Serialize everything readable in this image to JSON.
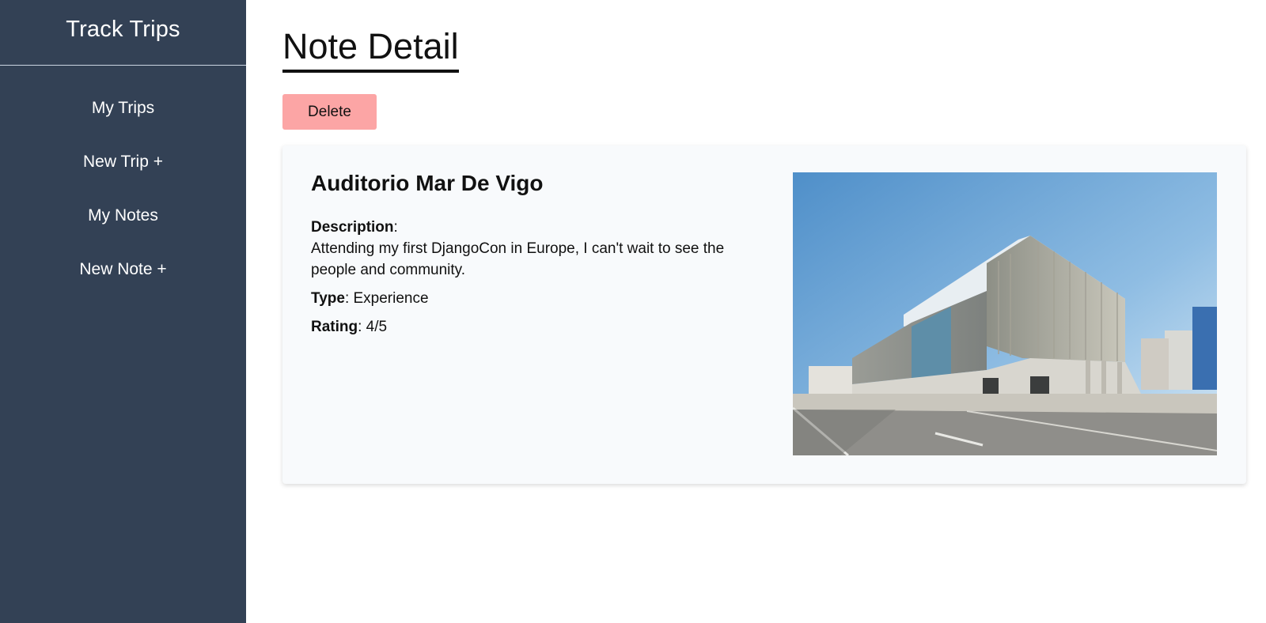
{
  "sidebar": {
    "brand": "Track Trips",
    "items": [
      {
        "label": "My Trips"
      },
      {
        "label": "New Trip +"
      },
      {
        "label": "My Notes"
      },
      {
        "label": "New Note +"
      }
    ]
  },
  "main": {
    "title": "Note Detail",
    "delete_label": "Delete",
    "note": {
      "name": "Auditorio Mar De Vigo",
      "description_label": "Description",
      "description": "Attending my first DjangoCon in Europe, I can't wait to see the people and community.",
      "type_label": "Type",
      "type": "Experience",
      "rating_label": "Rating",
      "rating": "4/5"
    }
  },
  "colors": {
    "sidebar_bg": "#334155",
    "delete_bg": "#fca5a5",
    "card_bg": "#f8fafc"
  }
}
